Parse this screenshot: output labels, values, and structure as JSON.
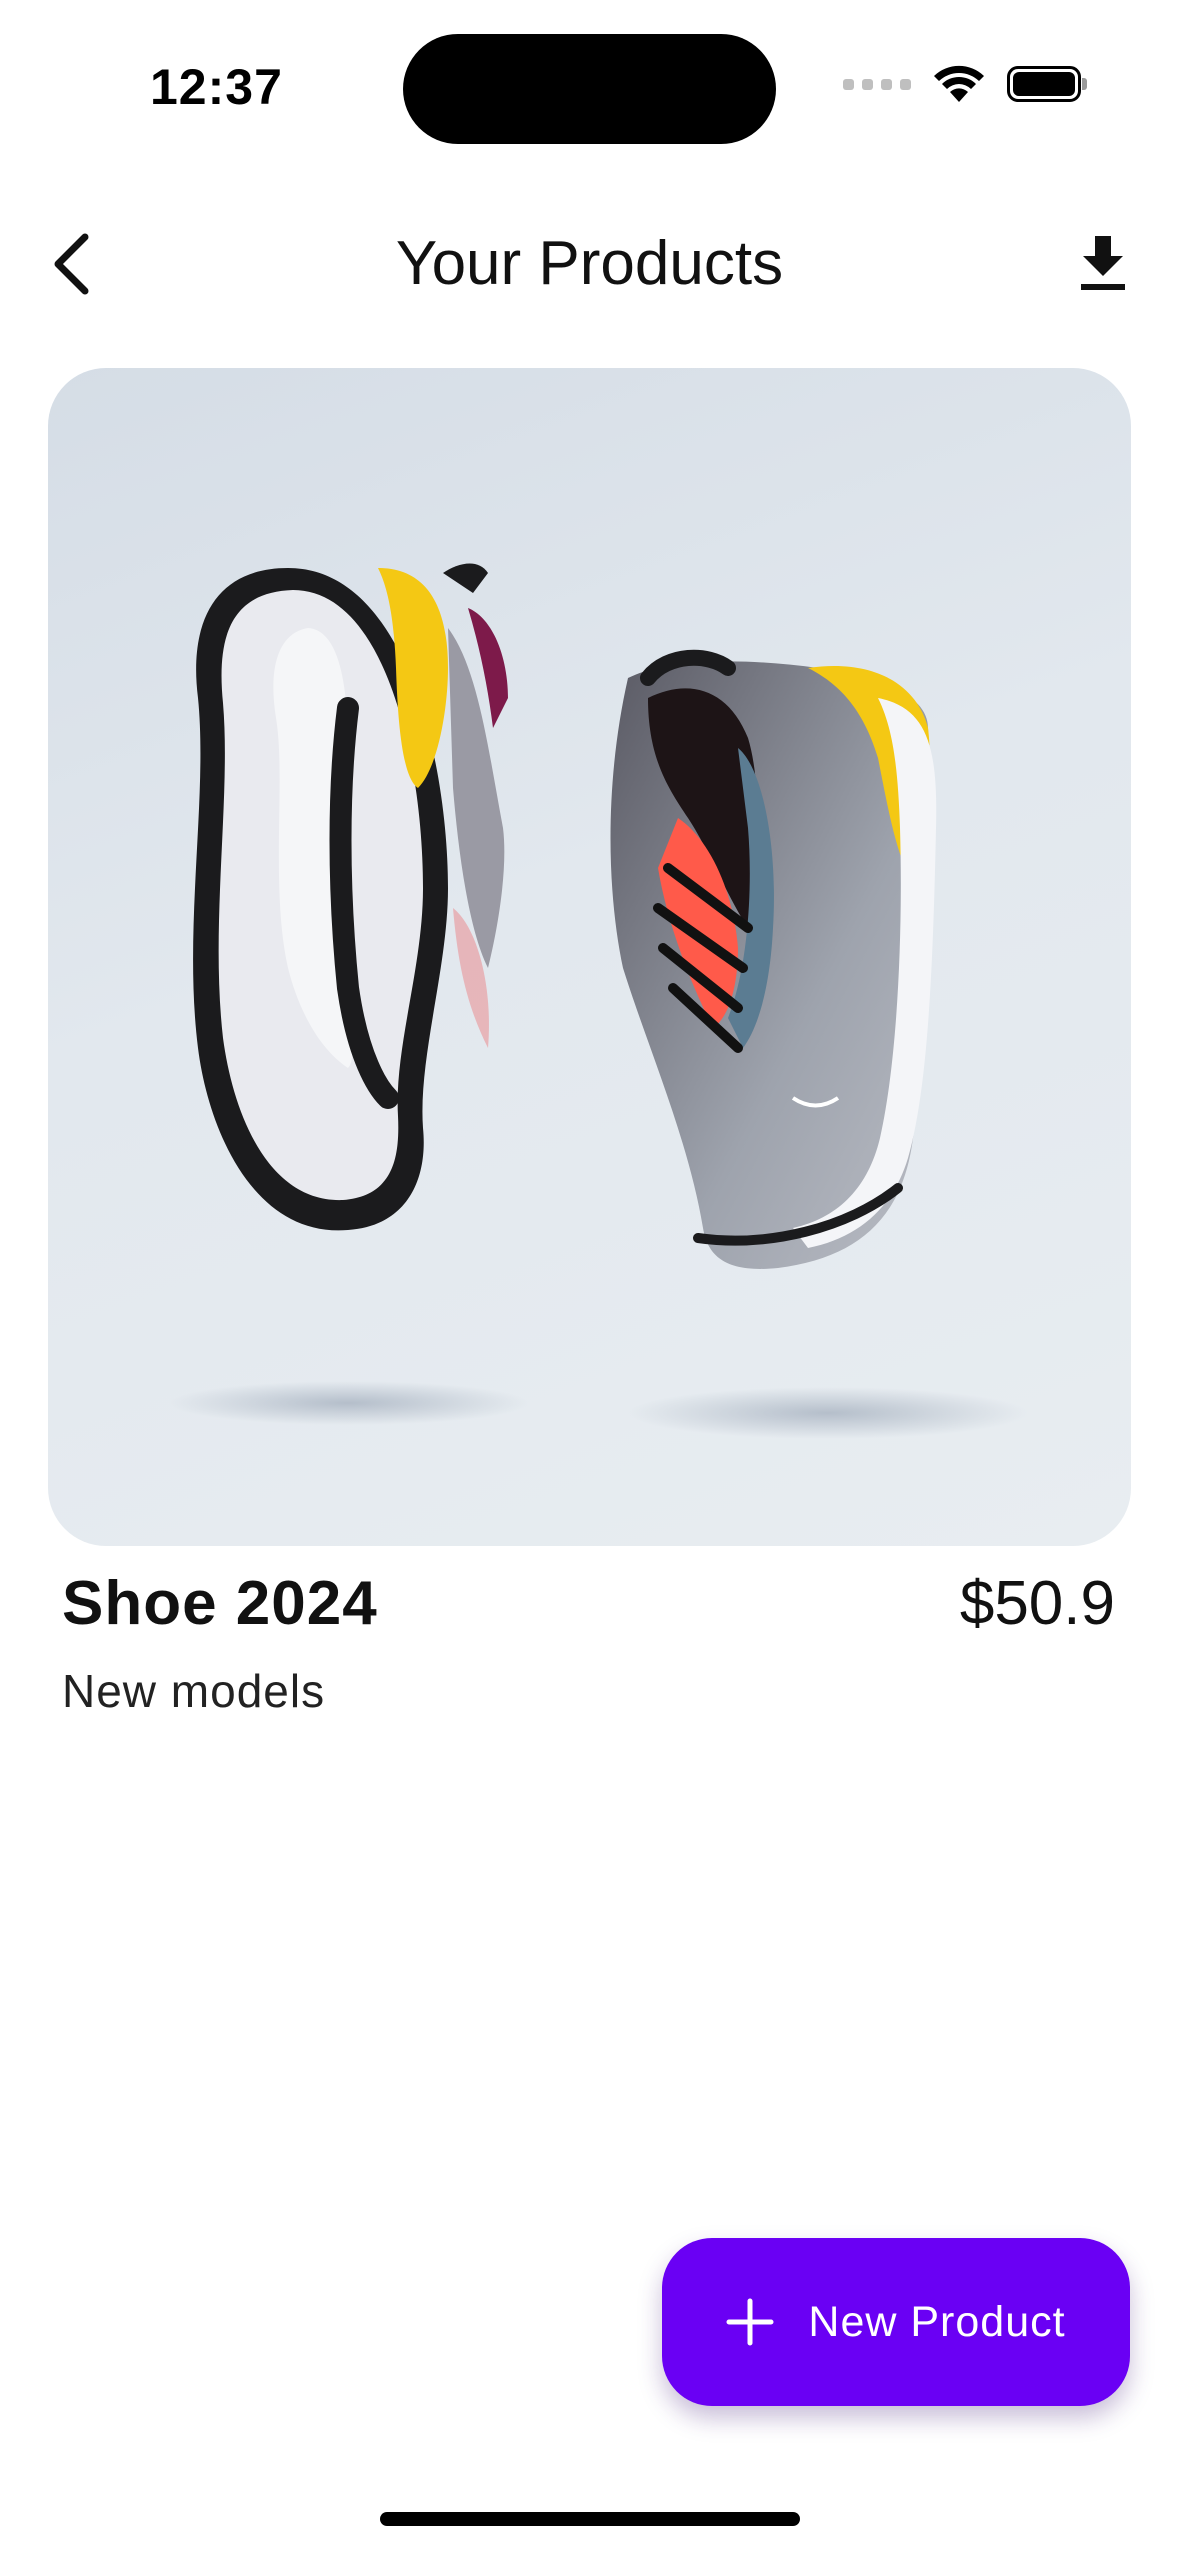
{
  "status_bar": {
    "time": "12:37",
    "icons": [
      "signal-icon",
      "wifi-icon",
      "battery-icon"
    ]
  },
  "header": {
    "title": "Your Products",
    "back_icon": "chevron-left-icon",
    "download_icon": "download-icon"
  },
  "products": [
    {
      "name": "Shoe 2024",
      "price": "$50.9",
      "subtitle": "New models",
      "image": "sneaker-pair-image"
    }
  ],
  "fab": {
    "label": "New Product",
    "icon": "plus-icon",
    "color": "#6a00f4"
  }
}
